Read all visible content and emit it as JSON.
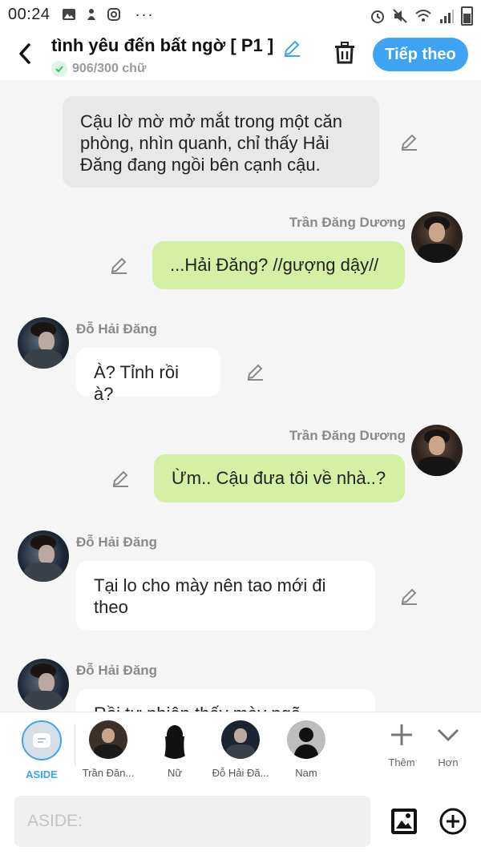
{
  "status_bar": {
    "time": "00:24",
    "more": "···"
  },
  "header": {
    "title": "tình yêu đến bất ngờ [ P1 ]",
    "word_count": "906/300 chữ",
    "next_label": "Tiếp theo"
  },
  "messages": [
    {
      "type": "narration",
      "text": "Cậu lờ mờ mở mắt trong một căn phòng, nhìn quanh, chỉ thấy Hải Đăng đang ngồi bên cạnh cậu."
    },
    {
      "type": "mine",
      "sender": "Trần Đăng Dương",
      "text": "...Hải Đăng? //gượng dậy//"
    },
    {
      "type": "other",
      "sender": "Đỗ Hải Đăng",
      "text": "À? Tỉnh rồi à?"
    },
    {
      "type": "mine",
      "sender": "Trần Đăng Dương",
      "text": "Ừm.. Cậu đưa tôi về nhà..?"
    },
    {
      "type": "other",
      "sender": "Đỗ Hải Đăng",
      "text": "Tại lo cho mày nên tao mới đi theo"
    },
    {
      "type": "other",
      "sender": "Đỗ Hải Đăng",
      "text": "Rồi tự nhiên thấy mày ngã"
    }
  ],
  "characters": [
    {
      "name": "ASIDE",
      "selected": true
    },
    {
      "name": "Trần Đăn..."
    },
    {
      "name": "Nữ"
    },
    {
      "name": "Đỗ Hải Đă..."
    },
    {
      "name": "Nam"
    }
  ],
  "tools": {
    "add_label": "Thêm",
    "more_label": "Hơn"
  },
  "input": {
    "placeholder": "ASIDE:"
  },
  "colors": {
    "accent": "#3ea3f2",
    "mine_bubble": "#d3f0a4",
    "narration_bubble": "#e8e8e8",
    "other_bubble": "#ffffff"
  }
}
